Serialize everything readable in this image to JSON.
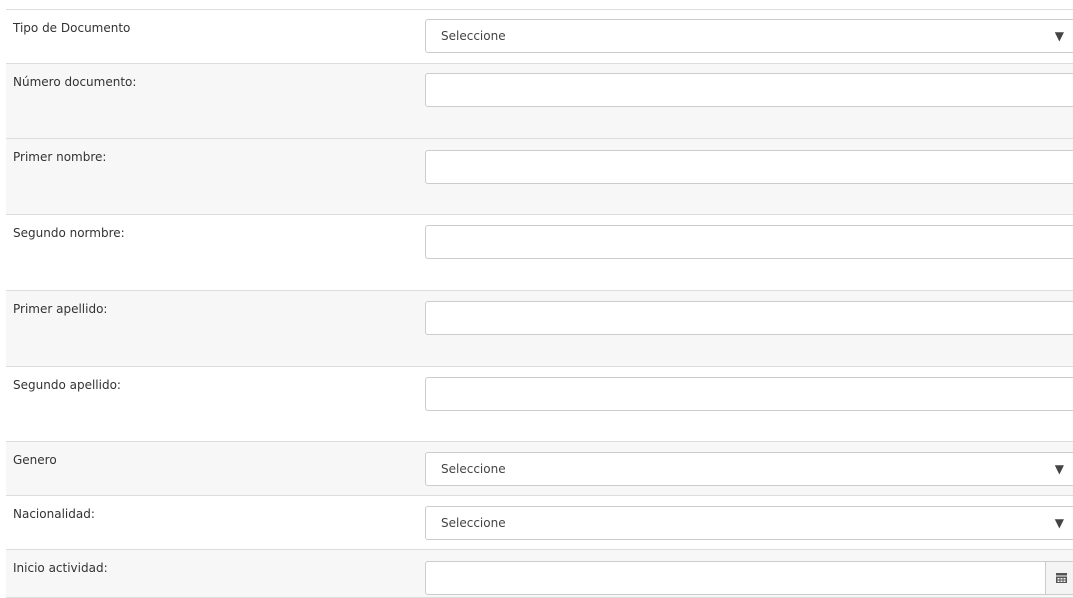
{
  "form": {
    "tipo_documento": {
      "label": "Tipo de Documento",
      "value": "Seleccione"
    },
    "numero_documento": {
      "label": "Número documento:",
      "value": ""
    },
    "primer_nombre": {
      "label": "Primer nombre:",
      "value": ""
    },
    "segundo_nombre": {
      "label": "Segundo normbre:",
      "value": ""
    },
    "primer_apellido": {
      "label": "Primer apellido:",
      "value": ""
    },
    "segundo_apellido": {
      "label": "Segundo apellido:",
      "value": ""
    },
    "genero": {
      "label": "Genero",
      "value": "Seleccione"
    },
    "nacionalidad": {
      "label": "Nacionalidad:",
      "value": "Seleccione"
    },
    "inicio_actividad": {
      "label": "Inicio actividad:",
      "value": ""
    }
  },
  "icons": {
    "dropdown": "caret-down-icon",
    "date": "calendar-icon"
  },
  "colors": {
    "row_stripe": "#f7f7f7",
    "border": "#cccccc",
    "divider": "#dddddd"
  }
}
